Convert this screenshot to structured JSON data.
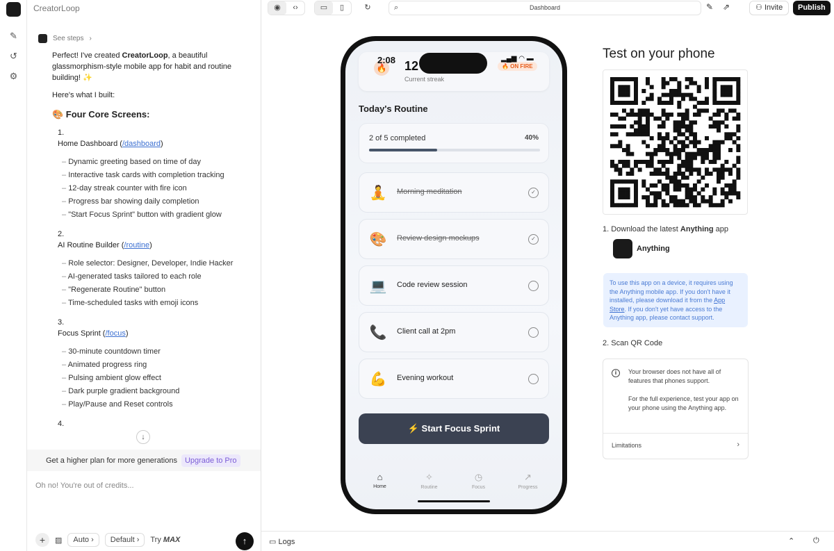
{
  "project": {
    "title": "CreatorLoop"
  },
  "chat": {
    "see_steps": "See steps",
    "intro_before": "Perfect! I've created ",
    "intro_bold": "CreatorLoop",
    "intro_after": ", a beautiful glassmorphism-style mobile app for habit and routine building! ✨",
    "built_label": "Here's what I built:",
    "core_heading": "🎨 Four Core Screens:",
    "sections": [
      {
        "num": "1.",
        "name": "Home Dashboard",
        "link": "/dashboard",
        "bullets": [
          "Dynamic greeting based on time of day",
          "Interactive task cards with completion tracking",
          "12-day streak counter with fire icon",
          "Progress bar showing daily completion",
          "\"Start Focus Sprint\" button with gradient glow"
        ]
      },
      {
        "num": "2.",
        "name": "AI Routine Builder",
        "link": "/routine",
        "bullets": [
          "Role selector: Designer, Developer, Indie Hacker",
          "AI-generated tasks tailored to each role",
          "\"Regenerate Routine\" button",
          "Time-scheduled tasks with emoji icons"
        ]
      },
      {
        "num": "3.",
        "name": "Focus Sprint",
        "link": "/focus",
        "bullets": [
          "30-minute countdown timer",
          "Animated progress ring",
          "Pulsing ambient glow effect",
          "Dark purple gradient background",
          "Play/Pause and Reset controls"
        ]
      }
    ],
    "next_num": "4.",
    "upsell_text": "Get a higher plan for more generations",
    "upsell_link": "Upgrade to Pro",
    "composer_placeholder": "Oh no! You're out of credits...",
    "auto_label": "Auto",
    "default_label": "Default",
    "try_label": "Try",
    "max_label": "MAX"
  },
  "toolbar": {
    "url": "Dashboard",
    "invite": "Invite",
    "publish": "Publish"
  },
  "bottombar": {
    "logs": "Logs"
  },
  "phone": {
    "time": "2:08",
    "streak_count": "12",
    "streak_label": "Current streak",
    "streak_badge": "🔥 ON FIRE",
    "section_title": "Today's Routine",
    "progress_text": "2 of 5 completed",
    "progress_pct": "40%",
    "progress_value": 0.4,
    "tasks": [
      {
        "emoji": "🧘",
        "name": "Morning meditation",
        "done": true
      },
      {
        "emoji": "🎨",
        "name": "Review design mockups",
        "done": true
      },
      {
        "emoji": "💻",
        "name": "Code review session",
        "done": false
      },
      {
        "emoji": "📞",
        "name": "Client call at 2pm",
        "done": false
      },
      {
        "emoji": "💪",
        "name": "Evening workout",
        "done": false
      }
    ],
    "focus_button": "⚡  Start Focus Sprint",
    "tabs": [
      {
        "icon": "⌂",
        "label": "Home",
        "active": true
      },
      {
        "icon": "✧",
        "label": "Routine",
        "active": false
      },
      {
        "icon": "◷",
        "label": "Focus",
        "active": false
      },
      {
        "icon": "↗",
        "label": "Progress",
        "active": false
      }
    ]
  },
  "test_panel": {
    "title": "Test on your phone",
    "step1_before": "1. Download the latest ",
    "step1_bold": "Anything",
    "step1_after": " app",
    "app_name": "Anything",
    "notice_before": "To use this app on a device, it requires using the Anything mobile app. If you don't have it installed, please download it from the ",
    "notice_link": "App Store",
    "notice_after": ". If you don't yet have access to the Anything app, please contact support.",
    "step2": "2. Scan QR Code",
    "lim_text1": "Your browser does not have all of features that phones support.",
    "lim_text2": "For the full experience, test your app on your phone using the Anything app.",
    "limitations": "Limitations"
  }
}
